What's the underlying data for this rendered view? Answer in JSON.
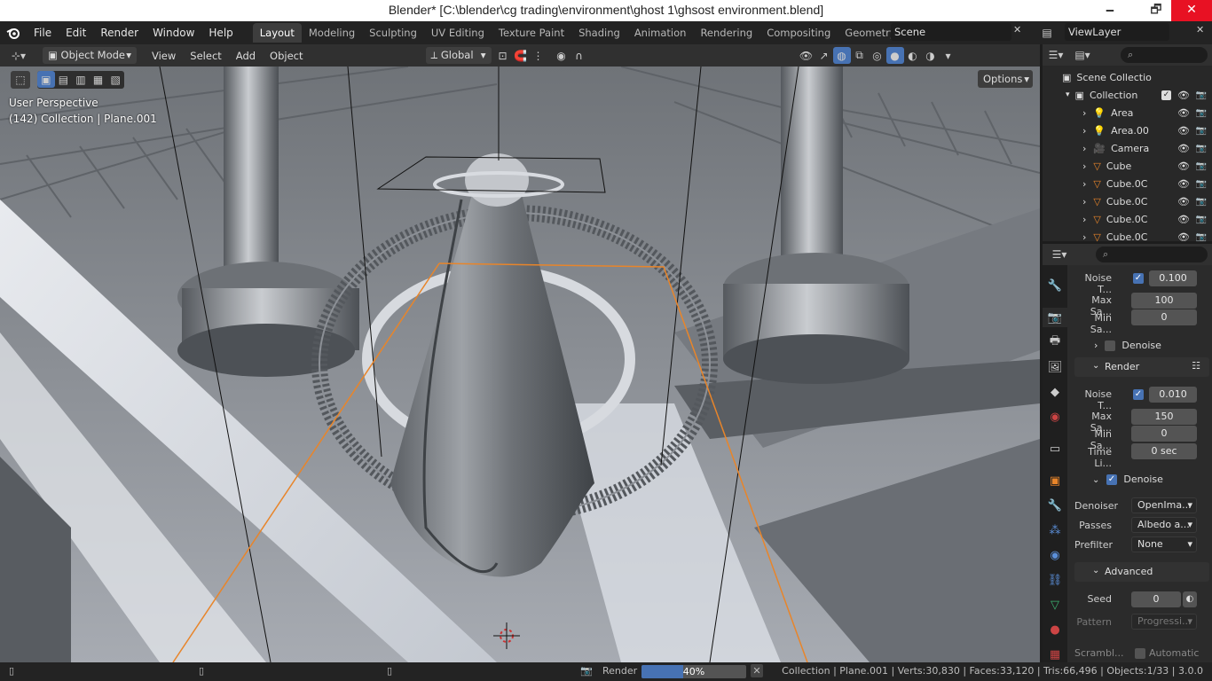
{
  "window": {
    "title": "Blender* [C:\\blender\\cg trading\\environment\\ghost 1\\ghsost environment.blend]",
    "min": "🗕",
    "max": "🗗",
    "close": "✕"
  },
  "menu": {
    "file": "File",
    "edit": "Edit",
    "render": "Render",
    "window": "Window",
    "help": "Help"
  },
  "workspaces": [
    "Layout",
    "Modeling",
    "Sculpting",
    "UV Editing",
    "Texture Paint",
    "Shading",
    "Animation",
    "Rendering",
    "Compositing",
    "Geometry Nod"
  ],
  "scene": {
    "name": "Scene",
    "view_layer": "ViewLayer"
  },
  "viewport_header": {
    "mode": "Object Mode",
    "view": "View",
    "select": "Select",
    "add": "Add",
    "object": "Object",
    "orientation": "Global",
    "options": "Options"
  },
  "viewport": {
    "perspective": "User Perspective",
    "collection_info": "(142) Collection | Plane.001"
  },
  "outliner": {
    "root": "Scene Collectio",
    "collection": "Collection",
    "items": [
      {
        "name": "Area",
        "icon": "light-icon"
      },
      {
        "name": "Area.00",
        "icon": "light-icon"
      },
      {
        "name": "Camera",
        "icon": "camera-icon"
      },
      {
        "name": "Cube",
        "icon": "mesh-icon"
      },
      {
        "name": "Cube.0C",
        "icon": "mesh-icon"
      },
      {
        "name": "Cube.0C",
        "icon": "mesh-icon"
      },
      {
        "name": "Cube.0C",
        "icon": "mesh-icon"
      },
      {
        "name": "Cube.0C",
        "icon": "mesh-icon"
      }
    ]
  },
  "properties": {
    "viewport_noise_label": "Noise T...",
    "viewport_noise_value": "0.100",
    "viewport_max_label": "Max Sa...",
    "viewport_max_value": "100",
    "viewport_min_label": "Min Sa...",
    "viewport_min_value": "0",
    "denoise_collapsed": "Denoise",
    "render_section": "Render",
    "render_noise_label": "Noise T...",
    "render_noise_value": "0.010",
    "render_max_label": "Max Sa...",
    "render_max_value": "150",
    "render_min_label": "Min Sa...",
    "render_min_value": "0",
    "time_label": "Time Li...",
    "time_value": "0 sec",
    "denoise_section": "Denoise",
    "denoiser_label": "Denoiser",
    "denoiser_value": "OpenIma...",
    "passes_label": "Passes",
    "passes_value": "Albedo a...",
    "prefilter_label": "Prefilter",
    "prefilter_value": "None",
    "advanced_section": "Advanced",
    "seed_label": "Seed",
    "seed_value": "0",
    "pattern_label": "Pattern",
    "pattern_value": "Progressi...",
    "scramble_label": "Scrambl...",
    "automatic_label": "Automatic"
  },
  "status": {
    "render_label": "Render",
    "progress_text": "40%",
    "progress": 0.4,
    "stats": "Collection | Plane.001 | Verts:30,830 | Faces:33,120 | Tris:66,496 | Objects:1/33 | 3.0.0"
  },
  "colors": {
    "accent": "#4772b3",
    "selection_orange": "#e8852a"
  }
}
